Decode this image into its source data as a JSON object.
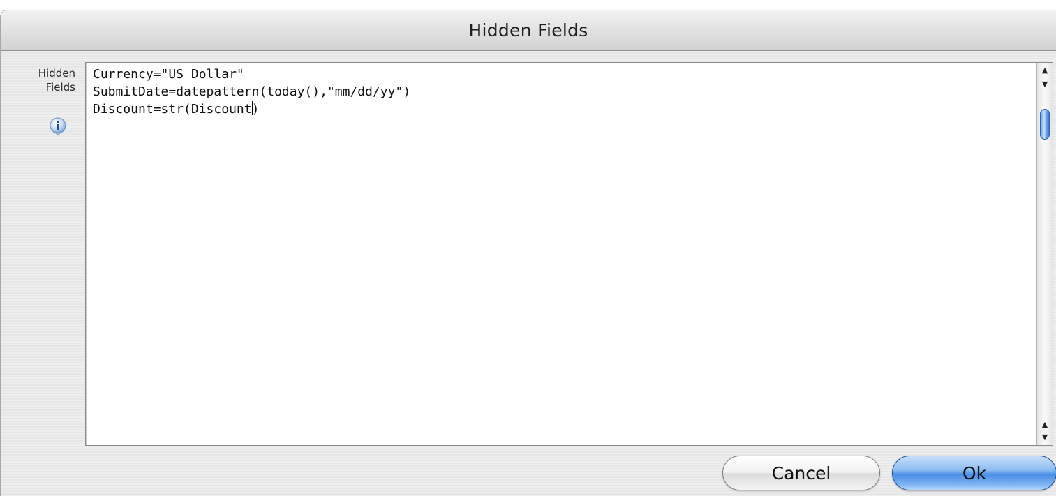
{
  "window": {
    "title": "Hidden Fields"
  },
  "field": {
    "label_line1": "Hidden",
    "label_line2": "Fields",
    "info_icon": "info-icon",
    "lines": [
      "Currency=\"US Dollar\"",
      "SubmitDate=datepattern(today(),\"mm/dd/yy\")",
      "Discount=str(Discount",
      ")"
    ]
  },
  "scrollbar": {
    "up_arrow": "▲",
    "down_arrow": "▼"
  },
  "buttons": {
    "cancel_label": "Cancel",
    "ok_label": "Ok"
  },
  "colors": {
    "default_button": "#4c8ee6",
    "thumb": "#6fa4e9"
  }
}
